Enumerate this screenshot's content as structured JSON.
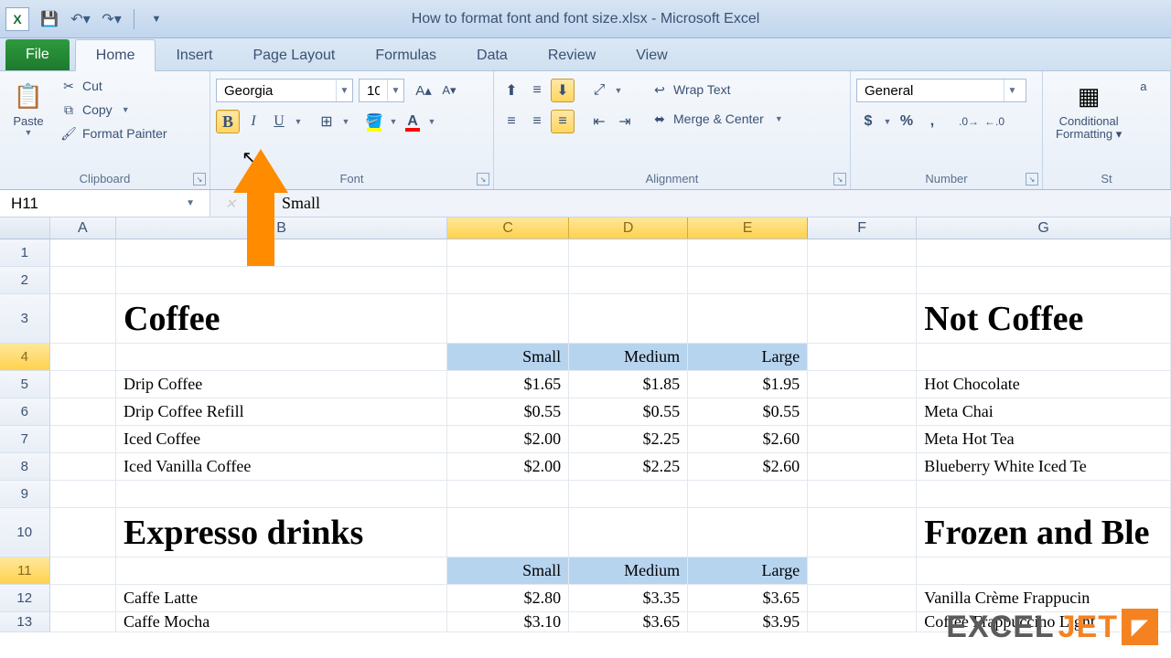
{
  "title": "How to format font and font size.xlsx  -  Microsoft Excel",
  "qat": {
    "save": "💾",
    "undo": "↶",
    "redo": "↷"
  },
  "tabs": {
    "file": "File",
    "items": [
      "Home",
      "Insert",
      "Page Layout",
      "Formulas",
      "Data",
      "Review",
      "View"
    ],
    "active": 0
  },
  "ribbon": {
    "clipboard": {
      "label": "Clipboard",
      "paste": "Paste",
      "cut": "Cut",
      "copy": "Copy",
      "painter": "Format Painter"
    },
    "font": {
      "label": "Font",
      "name": "Georgia",
      "size": "10",
      "bold_active": true
    },
    "alignment": {
      "label": "Alignment",
      "wrap": "Wrap Text",
      "merge": "Merge & Center"
    },
    "number": {
      "label": "Number",
      "format": "General"
    },
    "styles": {
      "cond": "Conditional\nFormatting",
      "label": "St"
    }
  },
  "name_box": "H11",
  "formula": "Small",
  "columns": [
    "A",
    "B",
    "C",
    "D",
    "E",
    "F",
    "G"
  ],
  "selected_cols": [
    "C",
    "D",
    "E"
  ],
  "rows": [
    "1",
    "2",
    "3",
    "4",
    "5",
    "6",
    "7",
    "8",
    "9",
    "10",
    "11",
    "12",
    "13"
  ],
  "selected_rows": [
    "4",
    "11"
  ],
  "cells": {
    "B3": "Coffee",
    "G3": "Not Coffee",
    "C4": "Small",
    "D4": "Medium",
    "E4": "Large",
    "B5": "Drip Coffee",
    "C5": "$1.65",
    "D5": "$1.85",
    "E5": "$1.95",
    "G5": "Hot Chocolate",
    "B6": "Drip Coffee Refill",
    "C6": "$0.55",
    "D6": "$0.55",
    "E6": "$0.55",
    "G6": "Meta Chai",
    "B7": "Iced Coffee",
    "C7": "$2.00",
    "D7": "$2.25",
    "E7": "$2.60",
    "G7": "Meta Hot Tea",
    "B8": "Iced Vanilla Coffee",
    "C8": "$2.00",
    "D8": "$2.25",
    "E8": "$2.60",
    "G8": "Blueberry White Iced Te",
    "B10": "Expresso drinks",
    "G10": "Frozen and Ble",
    "C11": "Small",
    "D11": "Medium",
    "E11": "Large",
    "B12": "Caffe Latte",
    "C12": "$2.80",
    "D12": "$3.35",
    "E12": "$3.65",
    "G12": "Vanilla Crème Frappucin",
    "B13": "Caffe Mocha",
    "C13": "$3.10",
    "D13": "$3.65",
    "E13": "$3.95",
    "G13": "Coffee Frappuccino Light"
  },
  "watermark": {
    "pre": "EXCEL",
    "suf": "JET"
  }
}
